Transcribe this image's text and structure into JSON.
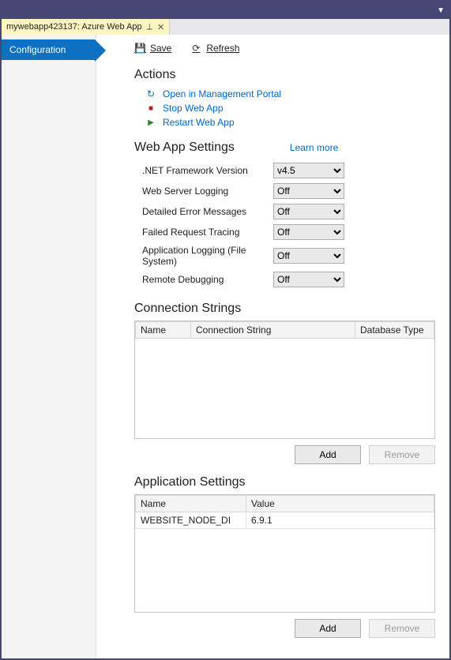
{
  "window": {
    "tab_title": "mywebapp423137: Azure Web App"
  },
  "sidebar": {
    "active": "Configuration"
  },
  "toolbar": {
    "save": "Save",
    "refresh": "Refresh"
  },
  "actions": {
    "heading": "Actions",
    "open": "Open in Management Portal",
    "stop": "Stop Web App",
    "restart": "Restart Web App"
  },
  "settings": {
    "heading": "Web App Settings",
    "learn_more": "Learn more",
    "rows": [
      {
        "label": ".NET Framework Version",
        "value": "v4.5"
      },
      {
        "label": "Web Server Logging",
        "value": "Off"
      },
      {
        "label": "Detailed Error Messages",
        "value": "Off"
      },
      {
        "label": "Failed Request Tracing",
        "value": "Off"
      },
      {
        "label": "Application Logging (File System)",
        "value": "Off"
      },
      {
        "label": "Remote Debugging",
        "value": "Off"
      }
    ]
  },
  "conn": {
    "heading": "Connection Strings",
    "cols": [
      "Name",
      "Connection String",
      "Database Type"
    ],
    "rows": [],
    "add": "Add",
    "remove": "Remove"
  },
  "appsettings": {
    "heading": "Application Settings",
    "cols": [
      "Name",
      "Value"
    ],
    "rows": [
      {
        "name": "WEBSITE_NODE_DI",
        "value": "6.9.1"
      }
    ],
    "add": "Add",
    "remove": "Remove"
  }
}
